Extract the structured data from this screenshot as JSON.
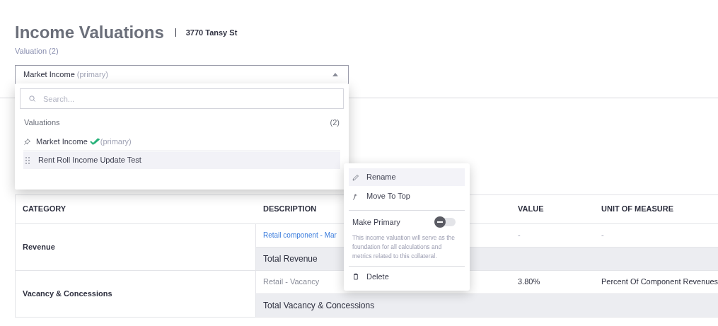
{
  "header": {
    "title": "Income Valuations",
    "address": "3770 Tansy St",
    "subtitle": "Valuation (2)"
  },
  "selector": {
    "value": "Market Income",
    "value_suffix": "(primary)",
    "expanded": true
  },
  "dropdown": {
    "search": {
      "placeholder": "Search..."
    },
    "group_label": "Valuations",
    "group_count": "(2)",
    "items": [
      {
        "label": "Market Income",
        "suffix": "(primary)",
        "kind": "pinned",
        "primary": true,
        "selected": false
      },
      {
        "label": "Rent Roll Income Update Test",
        "kind": "draggable",
        "primary": false,
        "selected": true
      }
    ]
  },
  "table": {
    "columns": [
      "CATEGORY",
      "DESCRIPTION",
      "VALUE",
      "UNIT OF MEASURE"
    ],
    "groups": [
      {
        "category": "Revenue",
        "rows": [
          {
            "kind": "item",
            "description": "Retail component - Mar",
            "link": true,
            "value": "-",
            "unit": "-"
          },
          {
            "kind": "total",
            "description": "Total Revenue"
          }
        ]
      },
      {
        "category": "Vacancy & Concessions",
        "rows": [
          {
            "kind": "item",
            "description": "Retail - Vacancy",
            "link": false,
            "value": "3.80%",
            "unit": "Percent Of Component Revenues"
          },
          {
            "kind": "total",
            "description": "Total Vacancy & Concessions"
          }
        ]
      }
    ]
  },
  "context_menu": {
    "items": [
      {
        "kind": "action",
        "label": "Rename",
        "selected": true
      },
      {
        "kind": "action",
        "label": "Move To Top",
        "selected": false
      },
      {
        "kind": "toggle",
        "label": "Make Primary",
        "on": false,
        "help": "This income valuation will serve as the foundation for all calculations and metrics related to this collateral."
      },
      {
        "kind": "action",
        "label": "Delete",
        "selected": false
      }
    ]
  }
}
